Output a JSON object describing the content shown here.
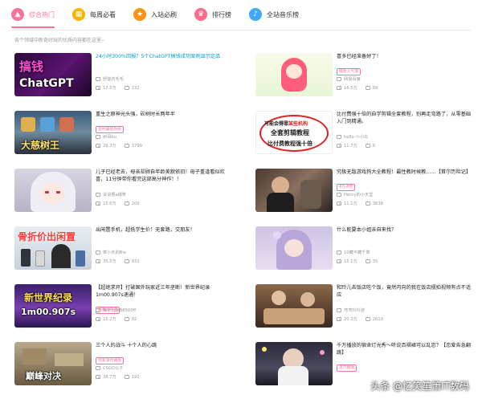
{
  "tabs": [
    {
      "label": "综合热门",
      "icon": "fire-icon",
      "glyph": "🔥",
      "active": true
    },
    {
      "label": "每周必看",
      "icon": "calendar-icon",
      "glyph": "▦",
      "active": false
    },
    {
      "label": "入站必刷",
      "icon": "star-icon",
      "glyph": "★",
      "active": false
    },
    {
      "label": "排行榜",
      "icon": "trophy-icon",
      "glyph": "♛",
      "active": false
    },
    {
      "label": "全站音乐榜",
      "icon": "music-icon",
      "glyph": "♪",
      "active": false
    }
  ],
  "subtitle": "各个领域中新奇好玩的优质内容都在这里~",
  "videos": [
    {
      "title": "24小时300%回报？5个ChatGPT搞钱成功案例显示定品",
      "tag": "",
      "up": "舒能内毛毛",
      "views": "17.5万",
      "comments": "232",
      "caption": "搞钱 ChatGPT"
    },
    {
      "title": "喜多已经准备好了！",
      "tag": "播放人气值",
      "up": "网易百度",
      "views": "16.5万",
      "comments": "89",
      "caption": ""
    },
    {
      "title": "重生之原神光头强，砍树时长两年半",
      "tag": "全村最能砍树",
      "up": "树哥bu",
      "views": "29.3万",
      "comments": "3799",
      "caption": "大慈树王"
    },
    {
      "title": "比付费强十倍的自学剪辑全套教程，别再走弯路了，从零基础入门到精通。",
      "tag": "",
      "up": "hello-小小鸟",
      "views": "11.7万",
      "comments": "6",
      "caption": "可能会得罪某些机构 全套剪辑教程 比付费教程强十倍"
    },
    {
      "title": "儿子已经老去，母亲却顾自年龄美貌依旧！母子重逢看似欢喜，11分钟带你看完这部高分神作！！",
      "tag": "",
      "up": "说说香a爆笑",
      "views": "15.6万",
      "comments": "206",
      "caption": ""
    },
    {
      "title": "究极无敌游戏狗大全教程！最性教时候教……【首尔历险记】",
      "tag": "4万点赞",
      "up": "Henry的小天堂",
      "views": "11.1万",
      "comments": "3638",
      "caption": ""
    },
    {
      "title": "出闲置手机，超低学生价！无套路，交朋友！",
      "tag": "",
      "up": "菜小杰的Bie",
      "views": "35.5万",
      "comments": "931",
      "caption": "骨折价出闲置"
    },
    {
      "title": "什么能要本小姐亲自来找？",
      "tag": "",
      "up": "10藏不藏千草",
      "views": "15.1万",
      "comments": "35",
      "caption": ""
    },
    {
      "title": "【超绝求开】打破国外玩家近三年垄断！新世界纪录1m00.907s速通！",
      "tag": "播放人气值",
      "up": "辣条玩家B8500ff",
      "views": "15.2万",
      "comments": "92",
      "caption": "新世界纪录 1m00.907s"
    },
    {
      "title": "和玲儿去饭店吃个饭，竟然内向的我在饭店摆拍视频有点不适应",
      "tag": "",
      "up": "弯弯玲玲游",
      "views": "20.3万",
      "comments": "2619",
      "caption": ""
    },
    {
      "title": "三个人的战斗 十个人的心跳",
      "tag": "玩家游戏播放",
      "up": "CSGO公子",
      "views": "38.7万",
      "comments": "191",
      "caption": "巅峰对决"
    },
    {
      "title": "千万播放的宿舍灯光秀～听说百褶裙可以乱忍？【恋爱告急翻跳】",
      "tag": "百万播放",
      "up": "",
      "views": "",
      "comments": "",
      "caption": ""
    }
  ],
  "watermark": "头条 @忆笑笙箫IT数码",
  "colors": {
    "accent": "#fb7299",
    "link": "#00a1d6"
  }
}
